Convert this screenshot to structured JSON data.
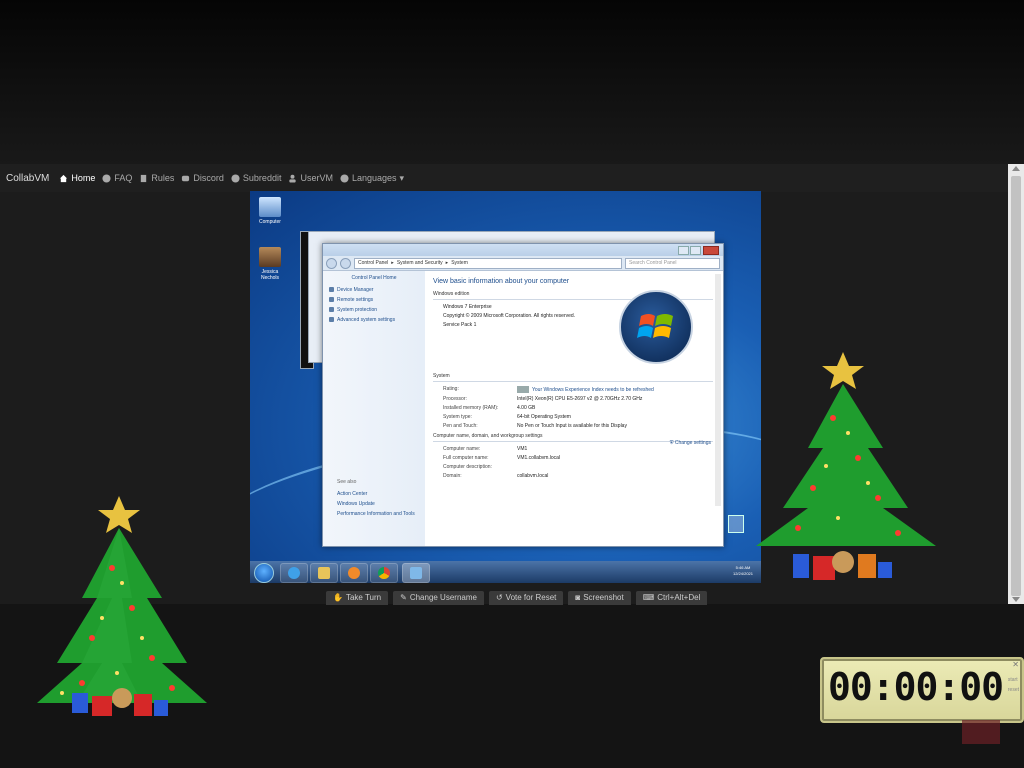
{
  "navbar": {
    "brand": "CollabVM",
    "items": [
      {
        "label": "Home",
        "icon": "home-icon",
        "active": true
      },
      {
        "label": "FAQ",
        "icon": "info-icon"
      },
      {
        "label": "Rules",
        "icon": "rules-icon"
      },
      {
        "label": "Discord",
        "icon": "chat-icon"
      },
      {
        "label": "Subreddit",
        "icon": "reddit-icon"
      },
      {
        "label": "UserVM",
        "icon": "user-icon"
      },
      {
        "label": "Languages",
        "icon": "globe-icon",
        "dropdown": true
      }
    ]
  },
  "vm": {
    "desktop_icons": [
      {
        "label": "Computer"
      },
      {
        "label": "Jessica Nechols"
      }
    ],
    "window": {
      "address": [
        "Control Panel",
        "System and Security",
        "System"
      ],
      "search_placeholder": "Search Control Panel",
      "left": {
        "home": "Control Panel Home",
        "links": [
          "Device Manager",
          "Remote settings",
          "System protection",
          "Advanced system settings"
        ],
        "see_also": "See also",
        "bottom_links": [
          "Action Center",
          "Windows Update",
          "Performance Information and Tools"
        ]
      },
      "heading": "View basic information about your computer",
      "edition_title": "Windows edition",
      "edition": [
        "Windows 7 Enterprise",
        "Copyright © 2009 Microsoft Corporation.  All rights reserved.",
        "Service Pack 1"
      ],
      "system_title": "System",
      "system_rows": [
        {
          "k": "Rating:",
          "v": "Your Windows Experience Index needs to be refreshed"
        },
        {
          "k": "Processor:",
          "v": "Intel(R) Xeon(R) CPU E5-2697 v2 @ 2.70GHz   2.70 GHz"
        },
        {
          "k": "Installed memory (RAM):",
          "v": "4.00 GB"
        },
        {
          "k": "System type:",
          "v": "64-bit Operating System"
        },
        {
          "k": "Pen and Touch:",
          "v": "No Pen or Touch Input is available for this Display"
        }
      ],
      "computer_title": "Computer name, domain, and workgroup settings",
      "change_settings": "Change settings",
      "computer_rows": [
        {
          "k": "Computer name:",
          "v": "VM1"
        },
        {
          "k": "Full computer name:",
          "v": "VM1.collabvm.local"
        },
        {
          "k": "Computer description:",
          "v": ""
        },
        {
          "k": "Domain:",
          "v": "collabvm.local"
        }
      ]
    },
    "tray": {
      "time": "5:46 AM",
      "date": "12/24/2021"
    }
  },
  "actions": [
    {
      "label": "Take Turn",
      "icon": "hand-icon"
    },
    {
      "label": "Change Username",
      "icon": "user-edit-icon"
    },
    {
      "label": "Vote for Reset",
      "icon": "reset-icon"
    },
    {
      "label": "Screenshot",
      "icon": "camera-icon"
    },
    {
      "label": "Ctrl+Alt+Del",
      "icon": "keyboard-icon"
    }
  ],
  "timer": {
    "display": "00:00:00",
    "side": [
      "start",
      "reset"
    ]
  },
  "colors": {
    "tree_green": "#1f9d2e",
    "star": "#e8c240",
    "timer_bg": "#e6e4ab"
  }
}
